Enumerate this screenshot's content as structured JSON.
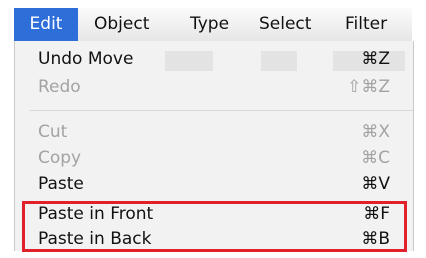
{
  "menubar": {
    "items": [
      {
        "label": "Edit",
        "active": true
      },
      {
        "label": "Object",
        "active": false
      },
      {
        "label": "Type",
        "active": false
      },
      {
        "label": "Select",
        "active": false
      },
      {
        "label": "Filter",
        "active": false
      }
    ]
  },
  "edit_menu": {
    "items": [
      {
        "label": "Undo Move",
        "shortcut": "⌘Z",
        "enabled": true
      },
      {
        "label": "Redo",
        "shortcut": "⇧⌘Z",
        "enabled": false
      },
      {
        "label": "Cut",
        "shortcut": "⌘X",
        "enabled": false
      },
      {
        "label": "Copy",
        "shortcut": "⌘C",
        "enabled": false
      },
      {
        "label": "Paste",
        "shortcut": "⌘V",
        "enabled": true
      },
      {
        "label": "Paste in Front",
        "shortcut": "⌘F",
        "enabled": true,
        "highlighted": true
      },
      {
        "label": "Paste in Back",
        "shortcut": "⌘B",
        "enabled": true,
        "highlighted": true
      }
    ]
  },
  "colors": {
    "menu_highlight": "#2d6ed9",
    "annotation_box": "#e0202a",
    "disabled_text": "#a3a3a3"
  }
}
